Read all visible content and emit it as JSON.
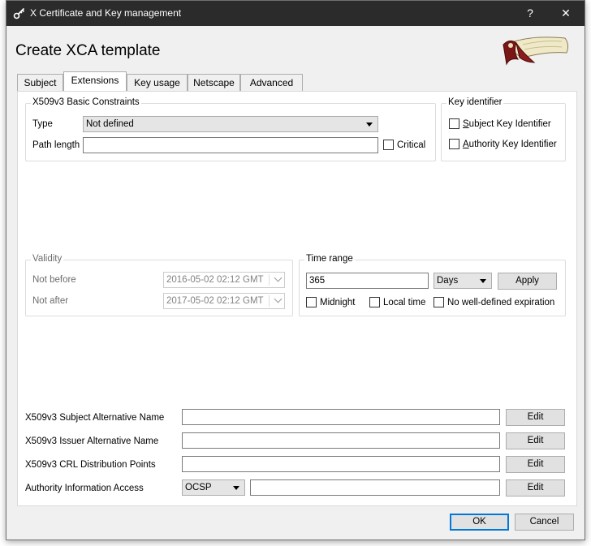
{
  "window": {
    "title": "X Certificate and Key management",
    "help_label": "?",
    "close_label": "✕",
    "app_icon": "key-icon"
  },
  "header": {
    "title": "Create XCA template",
    "logo": "scroll-logo"
  },
  "tabs": [
    {
      "label": "Subject",
      "active": false
    },
    {
      "label": "Extensions",
      "active": true
    },
    {
      "label": "Key usage",
      "active": false
    },
    {
      "label": "Netscape",
      "active": false
    },
    {
      "label": "Advanced",
      "active": false
    }
  ],
  "basic_constraints": {
    "title": "X509v3 Basic Constraints",
    "type_label": "Type",
    "type_value": "Not defined",
    "path_length_label": "Path length",
    "path_length_value": "",
    "critical_label": "Critical",
    "critical_checked": false
  },
  "key_identifier": {
    "title": "Key identifier",
    "subject_label_first": "S",
    "subject_label_rest": "ubject Key Identifier",
    "authority_label_first": "A",
    "authority_label_rest": "uthority Key Identifier"
  },
  "validity": {
    "title": "Validity",
    "not_before_label": "Not before",
    "not_before_value": "2016-05-02 02:12 GMT",
    "not_after_label": "Not after",
    "not_after_value": "2017-05-02 02:12 GMT"
  },
  "time_range": {
    "title": "Time range",
    "amount": "365",
    "unit": "Days",
    "apply_label": "Apply",
    "midnight_label": "Midnight",
    "local_time_label": "Local time",
    "no_expiration_label": "No well-defined expiration"
  },
  "extensions": {
    "san_label": "X509v3 Subject Alternative Name",
    "ian_label": "X509v3 Issuer Alternative Name",
    "crl_label": "X509v3 CRL Distribution Points",
    "aia_label": "Authority Information Access",
    "aia_type": "OCSP",
    "edit_label": "Edit"
  },
  "footer": {
    "ok_label": "OK",
    "cancel_label": "Cancel"
  },
  "colors": {
    "titlebar": "#2b2b2b",
    "default_button_border": "#0078d7"
  }
}
